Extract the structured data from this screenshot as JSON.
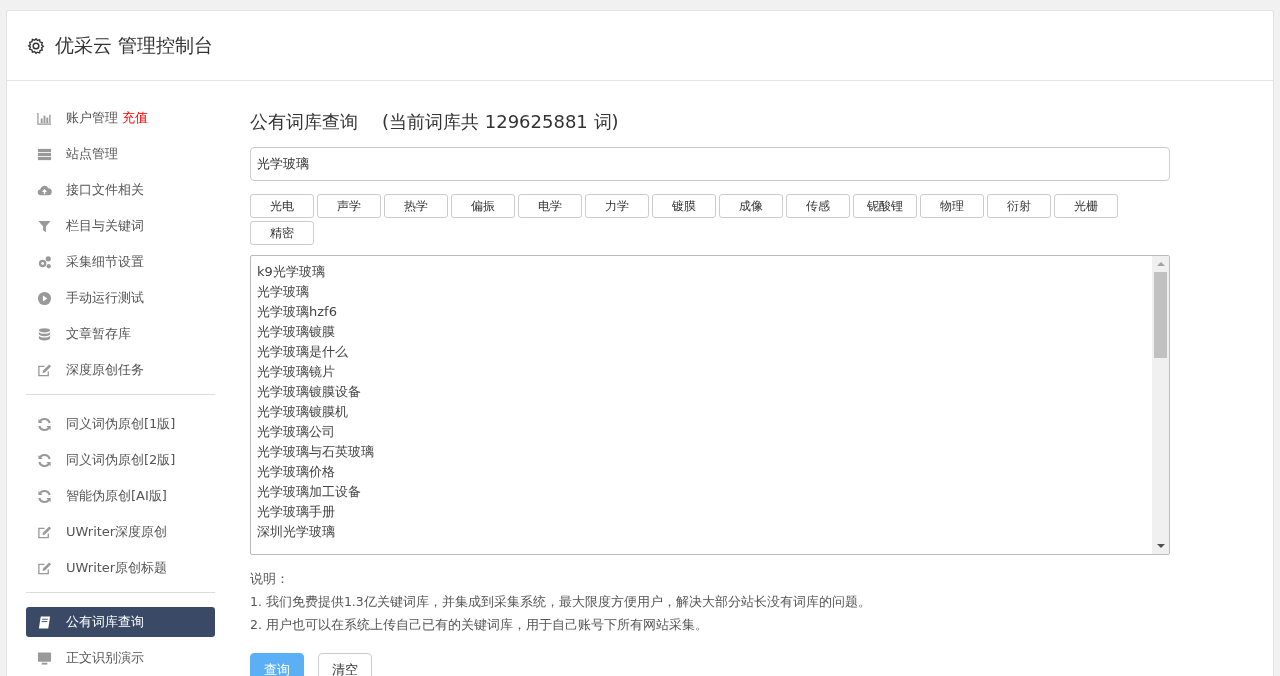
{
  "header": {
    "title": "优采云 管理控制台"
  },
  "sidebar": {
    "groups": [
      {
        "items": [
          {
            "kind": "bar-chart",
            "label": "账户管理",
            "badge": "充值",
            "selected": false
          },
          {
            "kind": "server",
            "label": "站点管理",
            "selected": false
          },
          {
            "kind": "cloud-upload",
            "label": "接口文件相关",
            "selected": false
          },
          {
            "kind": "filter",
            "label": "栏目与关键词",
            "selected": false
          },
          {
            "kind": "gears",
            "label": "采集细节设置",
            "selected": false
          },
          {
            "kind": "play",
            "label": "手动运行测试",
            "selected": false
          },
          {
            "kind": "database",
            "label": "文章暂存库",
            "selected": false
          },
          {
            "kind": "edit",
            "label": "深度原创任务",
            "selected": false
          }
        ]
      },
      {
        "items": [
          {
            "kind": "refresh",
            "label": "同义词伪原创[1版]",
            "selected": false
          },
          {
            "kind": "refresh",
            "label": "同义词伪原创[2版]",
            "selected": false
          },
          {
            "kind": "refresh",
            "label": "智能伪原创[AI版]",
            "selected": false
          },
          {
            "kind": "edit",
            "label": "UWriter深度原创",
            "selected": false
          },
          {
            "kind": "edit",
            "label": "UWriter原创标题",
            "selected": false
          }
        ]
      },
      {
        "items": [
          {
            "kind": "book",
            "label": "公有词库查询",
            "selected": true
          },
          {
            "kind": "desktop",
            "label": "正文识别演示",
            "selected": false
          }
        ]
      }
    ]
  },
  "main": {
    "title": "公有词库查询",
    "subtitle": "(当前词库共 129625881 词)",
    "search": {
      "value": "光学玻璃"
    },
    "tags": [
      "光电",
      "声学",
      "热学",
      "偏振",
      "电学",
      "力学",
      "镀膜",
      "成像",
      "传感",
      "铌酸锂",
      "物理",
      "衍射",
      "光栅",
      "精密"
    ],
    "results": [
      "k9光学玻璃",
      "光学玻璃",
      "光学玻璃hzf6",
      "光学玻璃镀膜",
      "光学玻璃是什么",
      "光学玻璃镜片",
      "光学玻璃镀膜设备",
      "光学玻璃镀膜机",
      "光学玻璃公司",
      "光学玻璃与石英玻璃",
      "光学玻璃价格",
      "光学玻璃加工设备",
      "光学玻璃手册",
      "深圳光学玻璃"
    ],
    "notes": {
      "heading": "说明：",
      "lines": [
        "1. 我们免费提供1.3亿关键词库，并集成到采集系统，最大限度方便用户，解决大部分站长没有词库的问题。",
        "2. 用户也可以在系统上传自己已有的关键词库，用于自己账号下所有网站采集。"
      ]
    },
    "buttons": [
      {
        "label": "查询",
        "kind": "primary"
      },
      {
        "label": "清空",
        "kind": "default"
      }
    ]
  }
}
